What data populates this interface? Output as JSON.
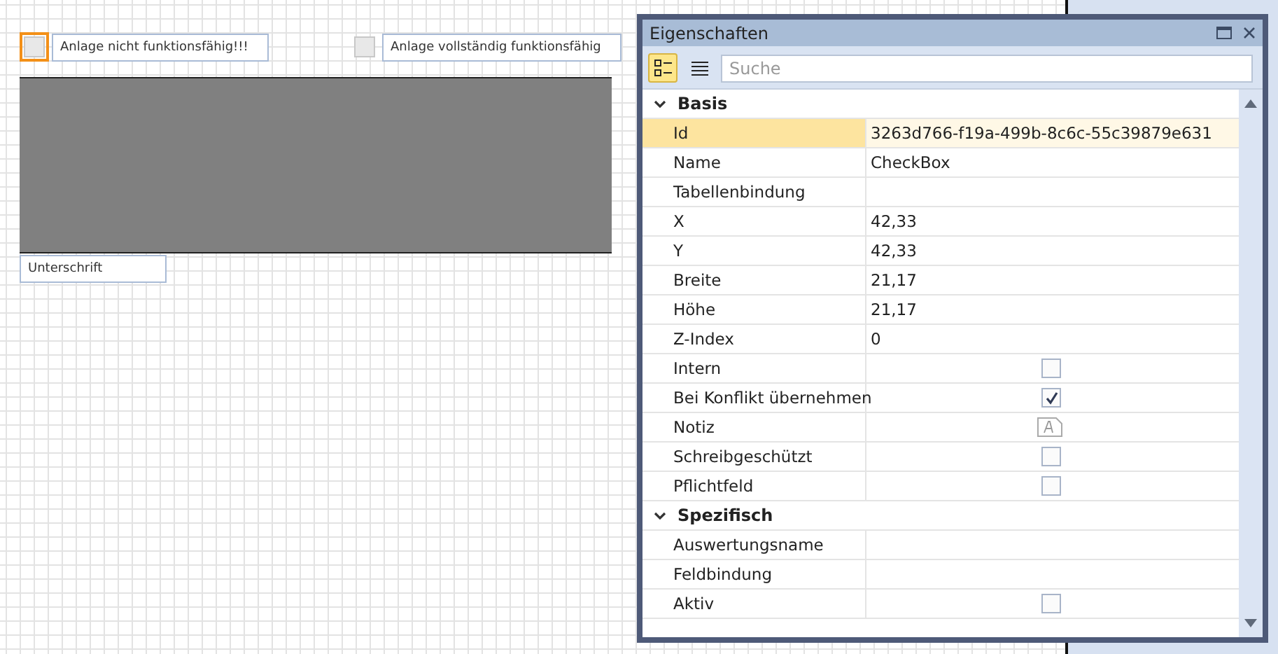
{
  "canvas": {
    "elements": [
      {
        "kind": "checkbox",
        "label": "Anlage nicht funktionsfähig!!!",
        "checked": false,
        "selected": true
      },
      {
        "kind": "checkbox",
        "label": "Anlage vollständig funktionsfähig",
        "checked": false,
        "selected": false
      },
      {
        "kind": "image"
      },
      {
        "kind": "label",
        "label": "Unterschrift"
      }
    ]
  },
  "properties": {
    "title": "Eigenschaften",
    "view_buttons": [
      {
        "kind": "categorized",
        "selected": true
      },
      {
        "kind": "alphabetical",
        "selected": false
      }
    ],
    "search": {
      "placeholder": "Suche"
    },
    "categories": [
      {
        "name": "Basis",
        "expanded": true,
        "rows": [
          {
            "name": "Id",
            "kind": "text",
            "value": "3263d766-f19a-499b-8c6c-55c39879e631",
            "selected": true
          },
          {
            "name": "Name",
            "kind": "text",
            "value": "CheckBox",
            "selected": false
          },
          {
            "name": "Tabellenbindung",
            "kind": "text",
            "selected": false
          },
          {
            "name": "X",
            "kind": "text",
            "value": "42,33",
            "selected": false
          },
          {
            "name": "Y",
            "kind": "text",
            "value": "42,33",
            "selected": false
          },
          {
            "name": "Breite",
            "kind": "text",
            "value": "21,17",
            "selected": false
          },
          {
            "name": "Höhe",
            "kind": "text",
            "value": "21,17",
            "selected": false
          },
          {
            "name": "Z-Index",
            "kind": "text",
            "value": "0",
            "selected": false
          },
          {
            "name": "Intern",
            "kind": "checkbox",
            "checked": false,
            "selected": false
          },
          {
            "name": "Bei Konflikt übernehmen",
            "kind": "checkbox",
            "checked": true,
            "selected": false
          },
          {
            "name": "Notiz",
            "kind": "note",
            "selected": false
          },
          {
            "name": "Schreibgeschützt",
            "kind": "checkbox",
            "checked": false,
            "selected": false
          },
          {
            "name": "Pflichtfeld",
            "kind": "checkbox",
            "checked": false,
            "selected": false
          }
        ]
      },
      {
        "name": "Spezifisch",
        "expanded": true,
        "rows": [
          {
            "name": "Auswertungsname",
            "kind": "text",
            "selected": false
          },
          {
            "name": "Feldbindung",
            "kind": "text",
            "selected": false
          },
          {
            "name": "Aktiv",
            "kind": "checkbox",
            "checked": false,
            "selected": false
          }
        ]
      }
    ]
  }
}
